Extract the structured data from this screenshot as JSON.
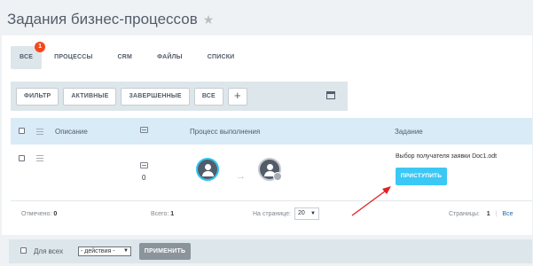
{
  "page": {
    "title": "Задания бизнес-процессов"
  },
  "tabs": [
    {
      "label": "ВСЕ",
      "badge": "1"
    },
    {
      "label": "ПРОЦЕССЫ"
    },
    {
      "label": "CRM"
    },
    {
      "label": "ФАЙЛЫ"
    },
    {
      "label": "СПИСКИ"
    }
  ],
  "filters": {
    "filter_label": "ФИЛЬТР",
    "active_label": "АКТИВНЫЕ",
    "completed_label": "ЗАВЕРШЕННЫЕ",
    "all_label": "ВСЕ",
    "plus_label": "+"
  },
  "table": {
    "headers": {
      "description": "Описание",
      "process": "Процесс выполнения",
      "task": "Задание"
    },
    "rows": [
      {
        "comments_count": "0",
        "task_name": "Выбор получателя заявки Doc1.odt",
        "action_label": "ПРИСТУПИТЬ"
      }
    ]
  },
  "footer": {
    "selected_label": "Отмечено:",
    "selected_value": "0",
    "total_label": "Всего:",
    "total_value": "1",
    "per_page_label": "На странице:",
    "per_page_value": "20",
    "pages_label": "Страницы:",
    "current_page": "1",
    "all_link": "Все"
  },
  "bottom": {
    "for_all_label": "Для всех",
    "action_select_value": "- действия -",
    "apply_label": "ПРИМЕНИТЬ"
  },
  "colors": {
    "accent": "#3bc8f5",
    "badge": "#f54819",
    "header_row": "#d8ebf6",
    "annotation_arrow": "#e02020"
  }
}
